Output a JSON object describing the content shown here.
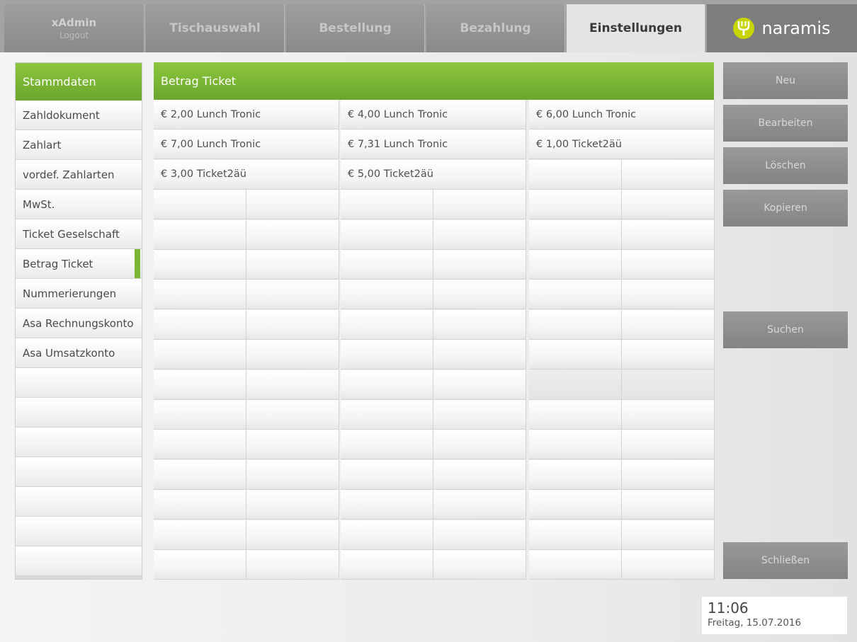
{
  "user": {
    "name": "xAdmin",
    "logout_label": "Logout"
  },
  "tabs": [
    {
      "label": "Tischauswahl"
    },
    {
      "label": "Bestellung"
    },
    {
      "label": "Bezahlung"
    },
    {
      "label": "Einstellungen"
    }
  ],
  "logo": {
    "text": "naramis",
    "icon": "fork-icon",
    "accent": "#c8d400"
  },
  "sidebar": {
    "header": "Stammdaten",
    "items": [
      {
        "label": "Zahldokument"
      },
      {
        "label": "Zahlart"
      },
      {
        "label": "vordef. Zahlarten"
      },
      {
        "label": "MwSt."
      },
      {
        "label": "Ticket Geselschaft"
      },
      {
        "label": "Betrag Ticket"
      },
      {
        "label": "Nummerierungen"
      },
      {
        "label": "Asa Rechnungskonto"
      },
      {
        "label": "Asa Umsatzkonto"
      }
    ],
    "selected": "Betrag Ticket"
  },
  "main": {
    "header": "Betrag Ticket",
    "entries": [
      "€ 2,00 Lunch Tronic",
      "€ 4,00 Lunch Tronic",
      "€ 6,00 Lunch Tronic",
      "€ 7,00 Lunch Tronic",
      "€ 7,31 Lunch Tronic",
      "€ 1,00 Ticket2äü",
      "€ 3,00 Ticket2äü",
      "€ 5,00 Ticket2äü"
    ]
  },
  "actions": {
    "new_label": "Neu",
    "edit_label": "Bearbeiten",
    "delete_label": "Löschen",
    "copy_label": "Kopieren",
    "search_label": "Suchen",
    "close_label": "Schließen"
  },
  "clock": {
    "time": "11:06",
    "date": "Freitag, 15.07.2016"
  },
  "colors": {
    "accent_green": "#7ab534",
    "tab_gray": "#8a8a8a",
    "button_gray": "#8e8e8e"
  }
}
